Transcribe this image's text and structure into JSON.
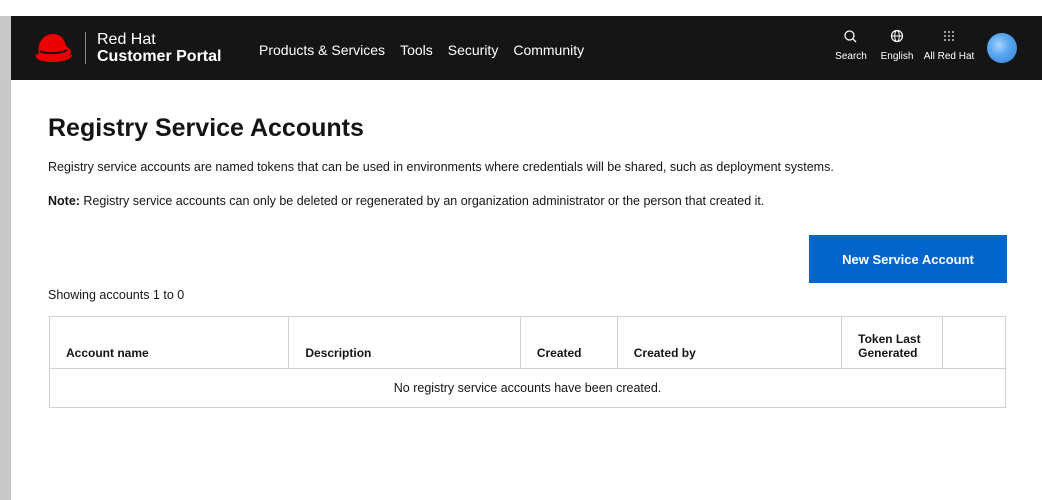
{
  "header": {
    "brand_line1": "Red Hat",
    "brand_line2": "Customer Portal",
    "nav": [
      "Products & Services",
      "Tools",
      "Security",
      "Community"
    ],
    "utilities": {
      "search": {
        "label": "Search",
        "icon": "search-icon"
      },
      "language": {
        "label": "English",
        "icon": "globe-icon"
      },
      "all": {
        "label": "All Red Hat",
        "icon": "grid-icon"
      }
    },
    "colors": {
      "background": "#151515",
      "logo": "#ee0000"
    }
  },
  "page": {
    "title": "Registry Service Accounts",
    "intro": "Registry service accounts are named tokens that can be used in environments where credentials will be shared, such as deployment systems.",
    "note_label": "Note:",
    "note_text": " Registry service accounts can only be deleted or regenerated by an organization administrator or the person that created it.",
    "new_button": "New Service Account",
    "showing": "Showing accounts 1 to 0",
    "table": {
      "columns": [
        "Account name",
        "Description",
        "Created",
        "Created by",
        "Token Last Generated",
        ""
      ],
      "rows": [],
      "empty_message": "No registry service accounts have been created."
    },
    "colors": {
      "primary_button": "#0066cc"
    }
  }
}
